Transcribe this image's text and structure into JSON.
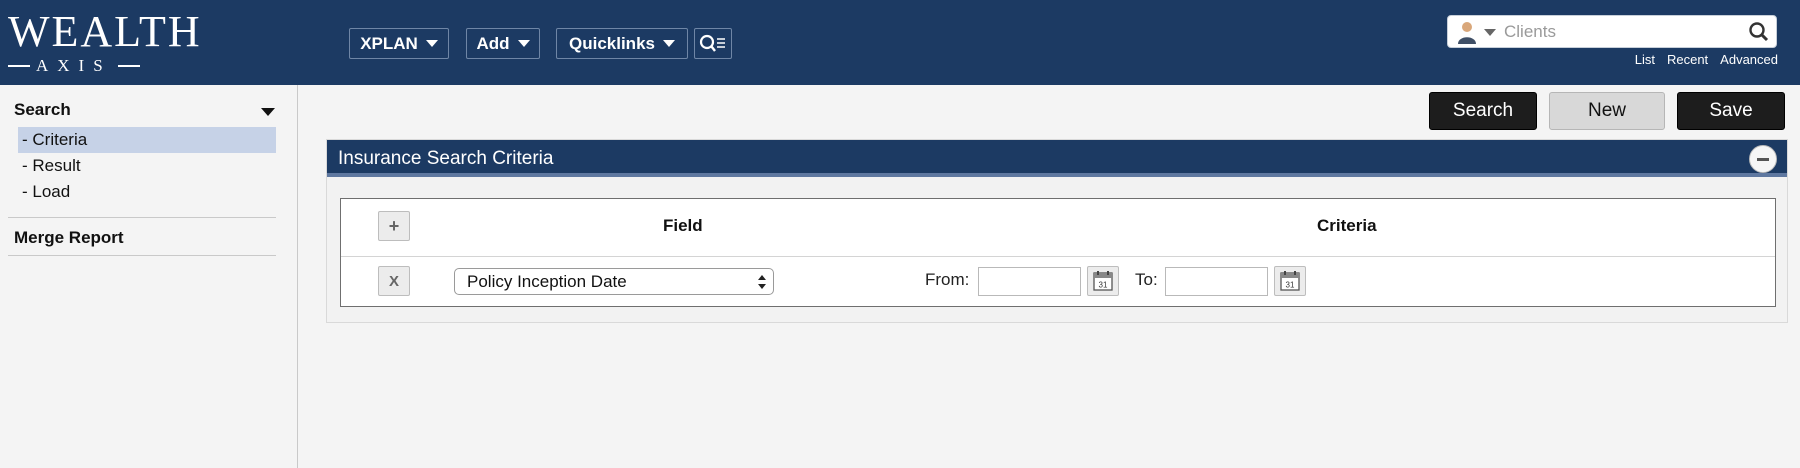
{
  "brand": {
    "logo_top": "WEALTH",
    "logo_bottom": "AXIS"
  },
  "topnav": {
    "xplan": "XPLAN",
    "add": "Add",
    "quicklinks": "Quicklinks"
  },
  "client_search": {
    "placeholder": "Clients",
    "links": [
      "List",
      "Recent",
      "Advanced"
    ]
  },
  "sidebar": {
    "title": "Search",
    "items": [
      "- Criteria",
      "- Result",
      "- Load"
    ],
    "active_index": 0,
    "merge_report": "Merge Report"
  },
  "actions": {
    "search": "Search",
    "new": "New",
    "save": "Save"
  },
  "panel": {
    "title": "Insurance Search Criteria",
    "add_symbol": "+",
    "remove_symbol": "X",
    "columns": {
      "field": "Field",
      "criteria": "Criteria"
    },
    "row": {
      "field_value": "Policy Inception Date",
      "from_label": "From:",
      "to_label": "To:",
      "from_value": "",
      "to_value": ""
    }
  },
  "colors": {
    "header": "#1c3a63",
    "active_item": "#c6d2e7",
    "dark_button": "#1d1d1d"
  }
}
